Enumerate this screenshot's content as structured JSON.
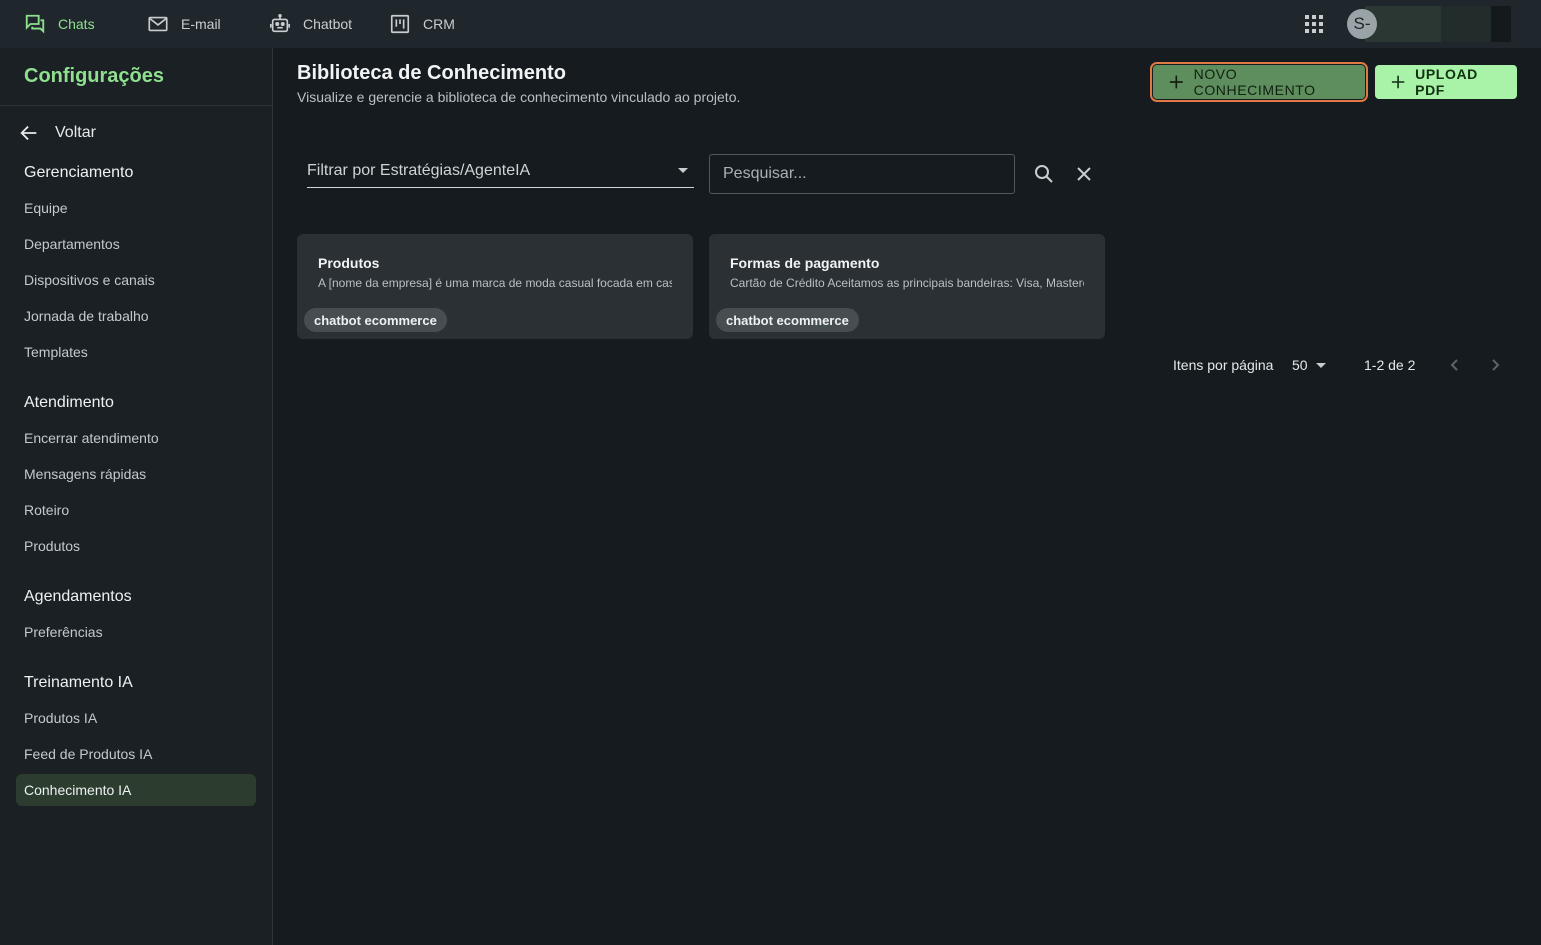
{
  "topnav": {
    "items": [
      {
        "label": "Chats",
        "icon": "chat-bubbles-icon",
        "active": true
      },
      {
        "label": "E-mail",
        "icon": "mail-icon",
        "active": false
      },
      {
        "label": "Chatbot",
        "icon": "robot-icon",
        "active": false
      },
      {
        "label": "CRM",
        "icon": "kanban-icon",
        "active": false
      }
    ],
    "avatar_initial": "S-"
  },
  "sidebar": {
    "title": "Configurações",
    "back_label": "Voltar",
    "sections": [
      {
        "heading": "Gerenciamento",
        "items": [
          "Equipe",
          "Departamentos",
          "Dispositivos e canais",
          "Jornada de trabalho",
          "Templates"
        ]
      },
      {
        "heading": "Atendimento",
        "items": [
          "Encerrar atendimento",
          "Mensagens rápidas",
          "Roteiro",
          "Produtos"
        ]
      },
      {
        "heading": "Agendamentos",
        "items": [
          "Preferências"
        ]
      },
      {
        "heading": "Treinamento IA",
        "items": [
          "Produtos IA",
          "Feed de Produtos IA",
          "Conhecimento IA"
        ]
      }
    ],
    "active_item": "Conhecimento IA"
  },
  "main": {
    "title": "Biblioteca de Conhecimento",
    "subtitle": "Visualize e gerencie a biblioteca de conhecimento vinculado ao projeto.",
    "new_button": "NOVO CONHECIMENTO",
    "upload_button": "UPLOAD PDF",
    "filter_label": "Filtrar por Estratégias/AgenteIA",
    "search_placeholder": "Pesquisar...",
    "cards": [
      {
        "title": "Produtos",
        "description": "A [nome da empresa] é uma marca de moda casual focada em casual",
        "tag": "chatbot ecommerce"
      },
      {
        "title": "Formas de pagamento",
        "description": "Cartão de Crédito Aceitamos as principais bandeiras: Visa, Mastercard",
        "tag": "chatbot ecommerce"
      }
    ],
    "pagination": {
      "items_per_page_label": "Itens por página",
      "items_per_page": "50",
      "range": "1-2 de 2"
    }
  },
  "colors": {
    "accent": "#8ee08e",
    "background": "#161b1f",
    "topbar": "#20272c",
    "card": "#2a3034",
    "primary_button": "#5e8e5e",
    "secondary_button": "#a8f3a8",
    "focus_outline": "#e07a45"
  }
}
